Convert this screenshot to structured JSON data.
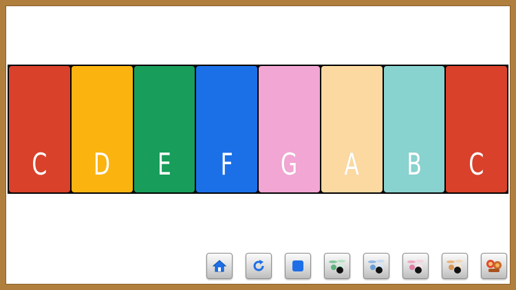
{
  "keys": [
    {
      "note": "C",
      "color": "#d9412a"
    },
    {
      "note": "D",
      "color": "#fbb40f"
    },
    {
      "note": "E",
      "color": "#189d5a"
    },
    {
      "note": "F",
      "color": "#1b70e8"
    },
    {
      "note": "G",
      "color": "#f1a6d3"
    },
    {
      "note": "A",
      "color": "#fcd9a1"
    },
    {
      "note": "B",
      "color": "#88d2cf"
    },
    {
      "note": "C",
      "color": "#d9412a"
    }
  ],
  "toolbar": {
    "buttons": [
      {
        "icon": "home-icon"
      },
      {
        "icon": "refresh-icon"
      },
      {
        "icon": "stop-icon"
      },
      {
        "icon": "drum-kit-green-icon"
      },
      {
        "icon": "drum-kit-blue-icon"
      },
      {
        "icon": "drum-kit-pink-icon"
      },
      {
        "icon": "drum-kit-orange-icon"
      },
      {
        "icon": "instruments-icon"
      }
    ]
  },
  "colors": {
    "frame": "#b07f3e",
    "accent_blue": "#1e6fe6"
  }
}
